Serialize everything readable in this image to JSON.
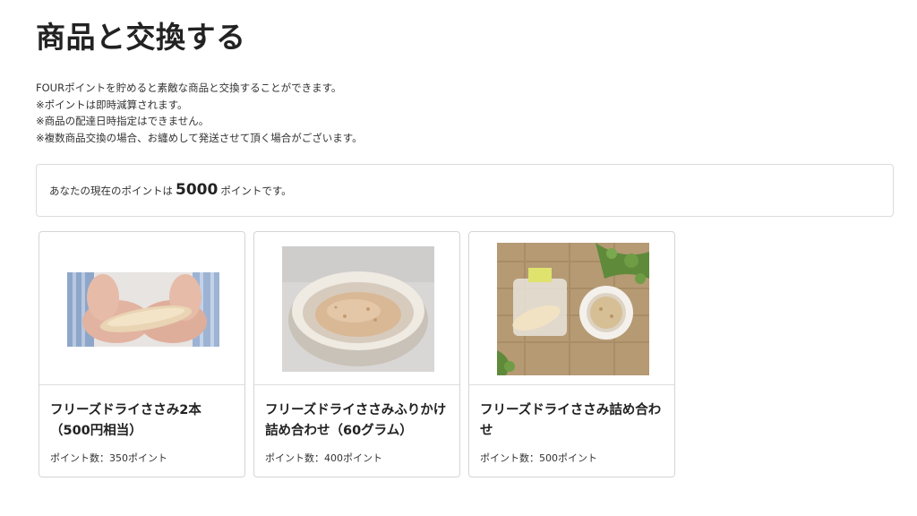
{
  "page": {
    "title": "商品と交換する",
    "description": [
      "FOURポイントを貯めると素敵な商品と交換することができます。",
      "※ポイントは即時減算されます。",
      "※商品の配達日時指定はできません。",
      "※複数商品交換の場合、お纏めして発送させて頂く場合がございます。"
    ]
  },
  "points": {
    "prefix": "あなたの現在のポイントは",
    "value": "5000",
    "suffix": "ポイントです。"
  },
  "products": [
    {
      "name": "フリーズドライささみ2本（500円相当）",
      "points": "ポイント数：350ポイント"
    },
    {
      "name": "フリーズドライささみふりかけ詰め合わせ（60グラム）",
      "points": "ポイント数：400ポイント"
    },
    {
      "name": "フリーズドライささみ詰め合わせ",
      "points": "ポイント数：500ポイント"
    }
  ]
}
